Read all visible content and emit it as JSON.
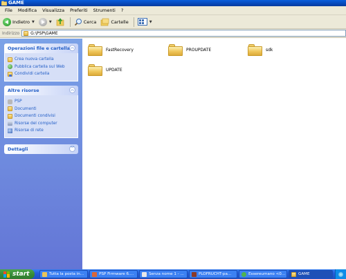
{
  "window": {
    "title": "GAME"
  },
  "menu": [
    "File",
    "Modifica",
    "Visualizza",
    "Preferiti",
    "Strumenti",
    "?"
  ],
  "toolbar": {
    "back_label": "Indietro",
    "search_label": "Cerca",
    "folders_label": "Cartelle"
  },
  "address": {
    "label": "Indirizzo",
    "value": "G:\\PSP\\GAME"
  },
  "sidebar": {
    "file_tasks": {
      "title": "Operazioni file e cartella",
      "items": [
        {
          "label": "Crea nuova cartella",
          "icon": "folder-icon"
        },
        {
          "label": "Pubblica cartella sul Web",
          "icon": "globe-icon"
        },
        {
          "label": "Condividi cartella",
          "icon": "share-folder-icon"
        }
      ]
    },
    "other_places": {
      "title": "Altre risorse",
      "items": [
        {
          "label": "PSP",
          "icon": "drive-icon"
        },
        {
          "label": "Documenti",
          "icon": "folder-icon"
        },
        {
          "label": "Documenti condivisi",
          "icon": "folder-icon"
        },
        {
          "label": "Risorse del computer",
          "icon": "computer-icon"
        },
        {
          "label": "Risorse di rete",
          "icon": "network-icon"
        }
      ]
    },
    "details": {
      "title": "Dettagli"
    }
  },
  "folders": [
    {
      "name": "FastRecovery"
    },
    {
      "name": "PROUPDATE"
    },
    {
      "name": "sdk"
    },
    {
      "name": "UPDATE"
    }
  ],
  "taskbar": {
    "start_label": "start",
    "tasks": [
      {
        "label": "Tutta la posta in...",
        "icon": "mail-icon",
        "active": false
      },
      {
        "label": "PSP Firmware 6....",
        "icon": "browser-icon",
        "active": false
      },
      {
        "label": "Senza nome 1 - ...",
        "icon": "document-icon",
        "active": false
      },
      {
        "label": "PLOFRUCHT-pa...",
        "icon": "app-icon",
        "active": false
      },
      {
        "label": "Essereumano <0...",
        "icon": "chat-icon",
        "active": false
      },
      {
        "label": "GAME",
        "icon": "folder-icon",
        "active": true
      }
    ]
  },
  "colors": {
    "titlebar": "#0747b8",
    "taskpane": "#6375d6",
    "link": "#215dc6",
    "start": "#368a36"
  }
}
